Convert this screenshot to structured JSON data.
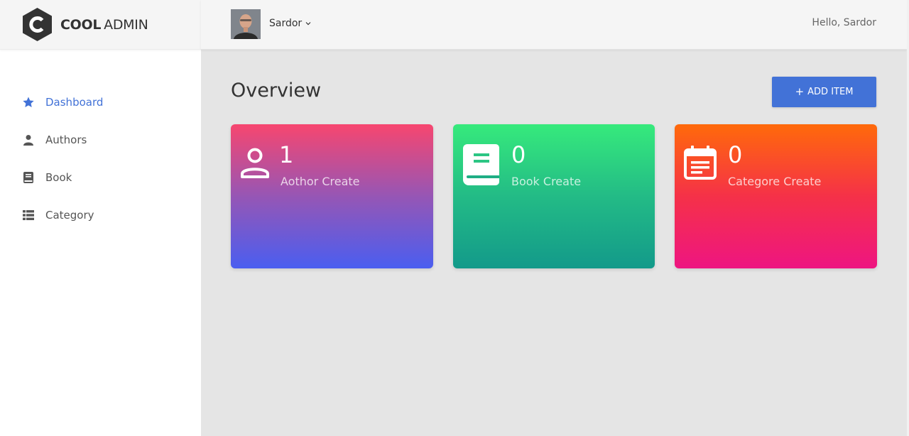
{
  "brand": {
    "bold": "COOL",
    "light": "ADMIN"
  },
  "sidebar": {
    "items": [
      {
        "label": "Dashboard",
        "icon": "star-icon",
        "active": true
      },
      {
        "label": "Authors",
        "icon": "user-icon",
        "active": false
      },
      {
        "label": "Book",
        "icon": "book-icon",
        "active": false
      },
      {
        "label": "Category",
        "icon": "list-icon",
        "active": false
      }
    ]
  },
  "header": {
    "user_name": "Sardor",
    "greeting": "Hello, Sardor"
  },
  "main": {
    "title": "Overview",
    "add_button": {
      "plus": "+",
      "label": "ADD ITEM"
    },
    "cards": [
      {
        "count": "1",
        "label": "Aothor Create",
        "icon": "person-outline-icon"
      },
      {
        "count": "0",
        "label": "Book Create",
        "icon": "book-icon"
      },
      {
        "count": "0",
        "label": "Categore Create",
        "icon": "calendar-icon"
      }
    ]
  },
  "colors": {
    "accent": "#4272d7",
    "card_1": [
      "#f7466f",
      "#4a5ef0"
    ],
    "card_2": [
      "#36ea7c",
      "#139a8a"
    ],
    "card_3": [
      "#ff6a0a",
      "#ee1581"
    ]
  }
}
